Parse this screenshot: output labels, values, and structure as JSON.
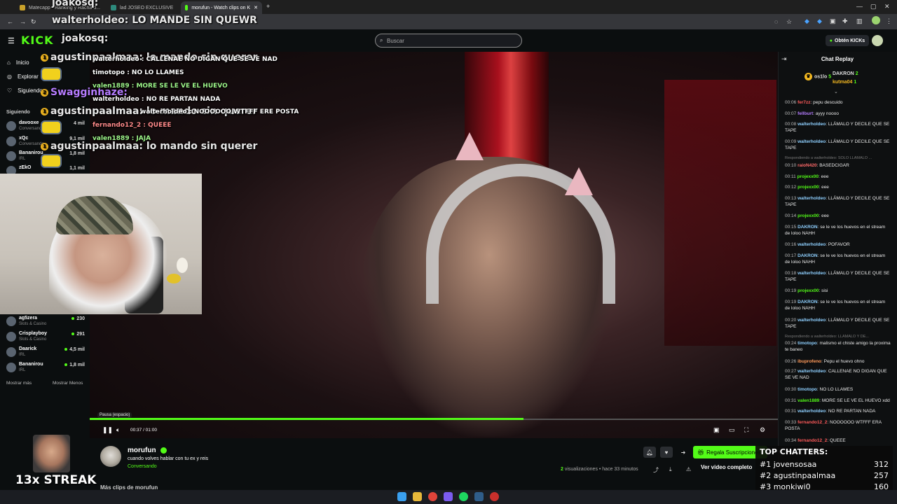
{
  "browser": {
    "tabs": [
      {
        "label": "Matecapp - Ranking y Racha d..."
      },
      {
        "label": "lad JOSEO EXCLUSIVE"
      },
      {
        "label": "morufun - Watch clips on K"
      }
    ],
    "new_tab": "+"
  },
  "header": {
    "logo": "KICK",
    "search_placeholder": "Buscar",
    "get_kicks": "Obtén KICKs"
  },
  "sidebar": {
    "nav": [
      {
        "label": "Inicio"
      },
      {
        "label": "Explorar"
      },
      {
        "label": "Siguiendo"
      }
    ],
    "following_heading": "Siguiendo",
    "channels_top": [
      {
        "name": "davooxe",
        "sub": "Conversando",
        "viewers": "4 mil"
      },
      {
        "name": "xQc",
        "sub": "Conversando",
        "viewers": "9,1 mil"
      },
      {
        "name": "Bananirou",
        "sub": "IRL",
        "viewers": "1,8 mil"
      },
      {
        "name": "zEkO",
        "sub": "",
        "viewers": "1,1 mil"
      }
    ],
    "channels_bottom": [
      {
        "name": "ag5zera",
        "sub": "Slots & Casino",
        "viewers": "230"
      },
      {
        "name": "Crisplayboy",
        "sub": "Slots & Casino",
        "viewers": "291"
      },
      {
        "name": "Daarick",
        "sub": "IRL",
        "viewers": "4,5 mil"
      },
      {
        "name": "Bananirou",
        "sub": "IRL",
        "viewers": "1,8 mil"
      }
    ],
    "show_more": "Mostrar más",
    "show_less": "Mostrar Menos"
  },
  "overlay_chat": {
    "line1_user": "joakosq:",
    "line2": "walterholdeo: LO MANDE SIN QUEWR",
    "line3_user": "joakosq:",
    "line4": "agustinpaalmaa: lo mando sin querer",
    "line5": "Swagginhaze:",
    "line6": "agustinpaalmaa: lo mando sin querer",
    "line7": "agustinpaalmaa: lo mando sin querer",
    "streamer_chat": [
      "walterholdeo : CALLENAE NO DIGAN QUE SE VE NAD",
      "timotopo : NO LO LLAMES",
      "valen1889 : MORE SE LE VE EL HUEVO",
      "walterholdeo : NO RE PARTAN NADA",
      "walterholdeo : NOOOOOO WTFFF ERE POSTA",
      "fernando12_2 : QUEEE",
      "valen1889 : JAJA"
    ]
  },
  "player": {
    "tooltip": "Pausa (espacio)",
    "time": "00:37 / 01:00",
    "progress": 0.63
  },
  "clip": {
    "channel": "morufun",
    "title": "cuando volves hablar con tu ex y reis",
    "category": "Conversando",
    "views_count": "2",
    "views_text": "visualizaciones • hace 33 minutos",
    "gift_label": "Regala Suscripciones",
    "full_video": "Ver video completo",
    "more_clips": "Más clips de morufun"
  },
  "chat_replay": {
    "title": "Chat Replay",
    "pinned": [
      {
        "name": "os1lo",
        "count": "5"
      },
      {
        "name": "DAKRON",
        "count": "2"
      },
      {
        "name": "kutma04",
        "count": "1"
      }
    ],
    "messages": [
      {
        "t": "00:06",
        "u": "fer7zz",
        "c": "#ff5a5a",
        "m": "pepu descuido"
      },
      {
        "t": "00:07",
        "u": "fellburt",
        "c": "#b57cff",
        "m": "ayyy noooo"
      },
      {
        "t": "00:08",
        "u": "walterholdeo",
        "c": "#8fd0ff",
        "m": "LLÁMALO Y DECILE QUE SE TAPE"
      },
      {
        "t": "00:09",
        "u": "walterholdeo",
        "c": "#8fd0ff",
        "m": "LLÁMALO Y DECILE QUE SE TAPE"
      },
      {
        "t": "00:10",
        "u": "raioN420",
        "c": "#ff6a6a",
        "m": "BASEDCIGAR"
      },
      {
        "t": "00:11",
        "u": "projexx00",
        "c": "#53fc18",
        "m": "eee"
      },
      {
        "t": "00:12",
        "u": "projexx00",
        "c": "#53fc18",
        "m": "eee"
      },
      {
        "t": "00:13",
        "u": "walterholdeo",
        "c": "#8fd0ff",
        "m": "LLÁMALO Y DECILE QUE SE TAPE"
      },
      {
        "t": "00:14",
        "u": "projexx00",
        "c": "#53fc18",
        "m": "eee"
      },
      {
        "t": "00:15",
        "u": "DAKRON",
        "c": "#8fd0ff",
        "m": "se le ve los huevos en el stream de loloo NAHH"
      },
      {
        "t": "00:16",
        "u": "walterholdeo",
        "c": "#8fd0ff",
        "m": "POFAVOR"
      },
      {
        "t": "00:17",
        "u": "DAKRON",
        "c": "#8fd0ff",
        "m": "se le ve los huevos en el stream de loloo NAHH"
      },
      {
        "t": "00:18",
        "u": "walterholdeo",
        "c": "#8fd0ff",
        "m": "LLÁMALO Y DECILE QUE SE TAPE"
      },
      {
        "t": "00:19",
        "u": "projexx00",
        "c": "#53fc18",
        "m": "sisi"
      },
      {
        "t": "00:19",
        "u": "DAKRON",
        "c": "#8fd0ff",
        "m": "se le ve los huevos en el stream de loloo NAHH"
      },
      {
        "t": "00:20",
        "u": "walterholdeo",
        "c": "#8fd0ff",
        "m": "LLÁMALO Y DECILE QUE SE TAPE"
      },
      {
        "t": "00:24",
        "u": "timotopo",
        "c": "#8fd0ff",
        "m": "malismo el chiste amigo la proxima te baneo"
      },
      {
        "t": "00:26",
        "u": "ibuprofeno",
        "c": "#ff9a5a",
        "m": "Pepu el huevo ohno"
      },
      {
        "t": "00:27",
        "u": "walterholdeo",
        "c": "#8fd0ff",
        "m": "CALLENAE NO DIGAN QUE SE VE NAD"
      },
      {
        "t": "00:30",
        "u": "timotopo",
        "c": "#8fd0ff",
        "m": "NO LO LLAMES"
      },
      {
        "t": "00:31",
        "u": "valen1889",
        "c": "#53fc18",
        "m": "MORE SE LE VE EL HUEVO xdd"
      },
      {
        "t": "00:31",
        "u": "walterholdeo",
        "c": "#8fd0ff",
        "m": "NO RE PARTAN NADA"
      },
      {
        "t": "00:33",
        "u": "fernando12_2",
        "c": "#ff5a5a",
        "m": "NOOOOOO WTFFF ERA POSTA"
      },
      {
        "t": "00:34",
        "u": "fernando12_2",
        "c": "#ff5a5a",
        "m": "QUEEE"
      }
    ],
    "reply1": "Respondiendo a walterholdeo: SOLO LLAMALO ...",
    "reply2": "Respondiendo a walterholdeo: LLÁMALO Y DE..."
  },
  "streak": "13x STREAK",
  "top_chatters": {
    "title": "TOP CHATTERS:",
    "rows": [
      {
        "rank": "#1",
        "name": "jovensosaa",
        "count": "312"
      },
      {
        "rank": "#2",
        "name": "agustinpaalmaa",
        "count": "257"
      },
      {
        "rank": "#3",
        "name": "monkiwi0",
        "count": "160"
      }
    ]
  }
}
